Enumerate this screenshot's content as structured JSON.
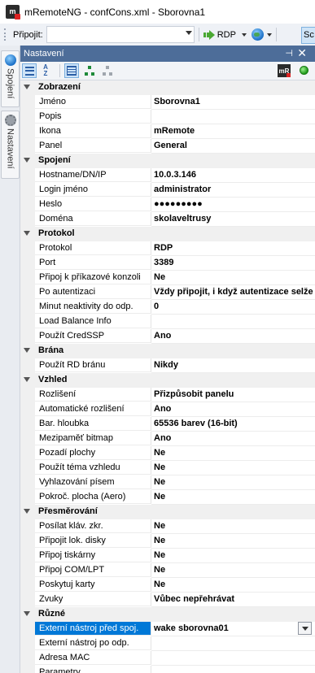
{
  "window": {
    "title": "mRemoteNG - confCons.xml - Sborovna1",
    "app_icon": "mremoteng-app-icon"
  },
  "toolbar": {
    "connect_label": "Připojit:",
    "connect_value": "",
    "protocol_label": "RDP",
    "right_button_label": "Sc"
  },
  "side_tabs": [
    {
      "label": "Spojení",
      "icon": "globe-icon"
    },
    {
      "label": "Nastavení",
      "icon": "gear-icon"
    }
  ],
  "panel": {
    "title": "Nastavení",
    "pin_glyph": "⊣",
    "close_glyph": "✕",
    "tools": [
      "categorized-view",
      "alphabetical-view",
      "properties-view",
      "default-inheritance",
      "inheritance"
    ],
    "status_color": "#1f9a1a"
  },
  "categories": [
    {
      "label": "Zobrazení",
      "props": [
        {
          "name": "Jméno",
          "value": "Sborovna1"
        },
        {
          "name": "Popis",
          "value": ""
        },
        {
          "name": "Ikona",
          "value": "mRemote"
        },
        {
          "name": "Panel",
          "value": "General"
        }
      ]
    },
    {
      "label": "Spojení",
      "props": [
        {
          "name": "Hostname/DN/IP",
          "value": "10.0.3.146"
        },
        {
          "name": "Login jméno",
          "value": "administrator"
        },
        {
          "name": "Heslo",
          "value": "●●●●●●●●●"
        },
        {
          "name": "Doména",
          "value": "skolaveltrusy"
        }
      ]
    },
    {
      "label": "Protokol",
      "props": [
        {
          "name": "Protokol",
          "value": "RDP"
        },
        {
          "name": "Port",
          "value": "3389"
        },
        {
          "name": "Připoj k příkazové konzoli",
          "value": "Ne"
        },
        {
          "name": "Po autentizaci",
          "value": "Vždy připojit, i když autentizace selže"
        },
        {
          "name": "Minut neaktivity do odp.",
          "value": "0"
        },
        {
          "name": "Load Balance Info",
          "value": ""
        },
        {
          "name": "Použít CredSSP",
          "value": "Ano"
        }
      ]
    },
    {
      "label": "Brána",
      "props": [
        {
          "name": "Použít RD bránu",
          "value": "Nikdy"
        }
      ]
    },
    {
      "label": "Vzhled",
      "props": [
        {
          "name": "Rozlišení",
          "value": "Přizpůsobit panelu"
        },
        {
          "name": "Automatické rozlišení",
          "value": "Ano"
        },
        {
          "name": "Bar. hloubka",
          "value": "65536 barev (16-bit)"
        },
        {
          "name": "Mezipaměť bitmap",
          "value": "Ano"
        },
        {
          "name": "Pozadí plochy",
          "value": "Ne"
        },
        {
          "name": "Použít téma vzhledu",
          "value": "Ne"
        },
        {
          "name": "Vyhlazování písem",
          "value": "Ne"
        },
        {
          "name": "Pokroč. plocha (Aero)",
          "value": "Ne"
        }
      ]
    },
    {
      "label": "Přesměrování",
      "props": [
        {
          "name": "Posílat kláv. zkr.",
          "value": "Ne"
        },
        {
          "name": "Připojit lok. disky",
          "value": "Ne"
        },
        {
          "name": "Připoj tiskárny",
          "value": "Ne"
        },
        {
          "name": "Připoj COM/LPT",
          "value": "Ne"
        },
        {
          "name": "Poskytuj karty",
          "value": "Ne"
        },
        {
          "name": "Zvuky",
          "value": "Vůbec nepřehrávat"
        }
      ]
    },
    {
      "label": "Různé",
      "props": [
        {
          "name": "Externí nástroj před spoj.",
          "value": "wake sborovna01",
          "selected": true
        },
        {
          "name": "Externí nástroj po odp.",
          "value": ""
        },
        {
          "name": "Adresa MAC",
          "value": ""
        },
        {
          "name": "Parametry",
          "value": ""
        }
      ]
    }
  ]
}
